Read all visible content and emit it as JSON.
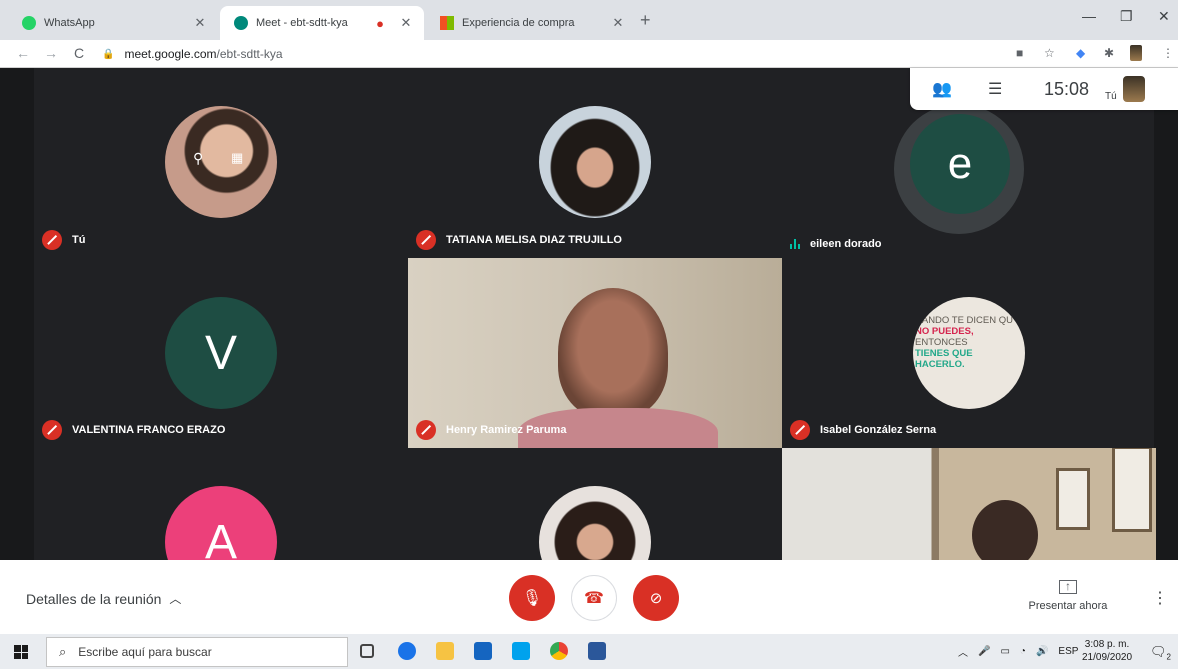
{
  "browser": {
    "tabs": [
      {
        "title": "WhatsApp",
        "active": false,
        "icon": "whatsapp-icon",
        "color": "#25d366"
      },
      {
        "title": "Meet - ebt-sdtt-kya",
        "active": true,
        "icon": "meet-icon",
        "color": "#00897b"
      },
      {
        "title": "Experiencia de compra",
        "active": false,
        "icon": "microsoft-icon",
        "color": "#f25022"
      }
    ],
    "url_host": "meet.google.com",
    "url_path": "/ebt-sdtt-kya"
  },
  "meet": {
    "clock": "15:08",
    "self_label": "Tú",
    "participants": [
      {
        "name": "Tú",
        "status": "muted",
        "kind": "photo"
      },
      {
        "name": "TATIANA MELISA DIAZ TRUJILLO",
        "status": "muted",
        "kind": "photo"
      },
      {
        "name": "eileen dorado",
        "status": "speaking",
        "kind": "letter",
        "letter": "e",
        "color": "#1e4d43"
      },
      {
        "name": "VALENTINA FRANCO ERAZO",
        "status": "muted",
        "kind": "letter",
        "letter": "V",
        "color": "#1e4d43"
      },
      {
        "name": "Henry Ramirez Paruma",
        "status": "muted",
        "kind": "video"
      },
      {
        "name": "Isabel González Serna",
        "status": "muted",
        "kind": "image"
      },
      {
        "name": "",
        "status": "",
        "kind": "letter",
        "letter": "A",
        "color": "#ec407a"
      },
      {
        "name": "",
        "status": "",
        "kind": "photo"
      },
      {
        "name": "",
        "status": "",
        "kind": "video"
      }
    ],
    "quote_lines": [
      "UANDO TE DICEN QU",
      "NO PUEDES,",
      "ENTONCES",
      "TIENES QUE",
      "HACERLO."
    ],
    "details_label": "Detalles de la reunión",
    "present_label": "Presentar ahora",
    "colors": {
      "danger": "#d93025",
      "accent": "#1e4d43"
    }
  },
  "taskbar": {
    "search_placeholder": "Escribe aquí para buscar",
    "lang": "ESP",
    "time": "3:08 p. m.",
    "date": "21/09/2020",
    "notif_count": "2"
  }
}
